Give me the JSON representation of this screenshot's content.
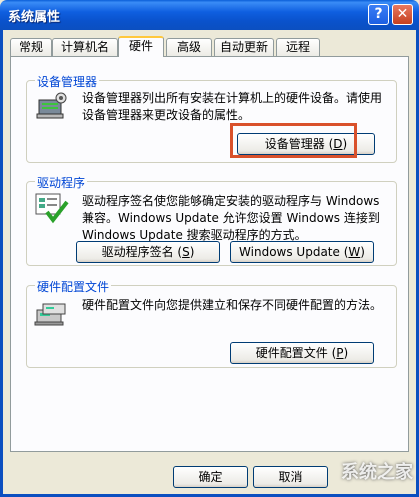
{
  "window": {
    "title": "系统属性"
  },
  "titlebar": {
    "help": "?",
    "close": "✕"
  },
  "tabs": [
    {
      "label": "常规"
    },
    {
      "label": "计算机名"
    },
    {
      "label": "硬件"
    },
    {
      "label": "高级"
    },
    {
      "label": "自动更新"
    },
    {
      "label": "远程"
    }
  ],
  "device_manager": {
    "title": "设备管理器",
    "description": "设备管理器列出所有安装在计算机上的硬件设备。请使用设备管理器来更改设备的属性。",
    "button_label": "设备管理器",
    "button_key": "D"
  },
  "drivers": {
    "title": "驱动程序",
    "description": "驱动程序签名使您能够确定安装的驱动程序与 Windows 兼容。Windows Update 允许您设置 Windows 连接到 Windows Update 搜索驱动程序的方式。",
    "sign_button_label": "驱动程序签名",
    "sign_button_key": "S",
    "update_button_label": "Windows Update",
    "update_button_key": "W"
  },
  "profiles": {
    "title": "硬件配置文件",
    "description": "硬件配置文件向您提供建立和保存不同硬件配置的方法。",
    "button_label": "硬件配置文件",
    "button_key": "P"
  },
  "footer": {
    "ok_label": "确定",
    "cancel_label": "取消"
  },
  "watermark": "系统之家"
}
